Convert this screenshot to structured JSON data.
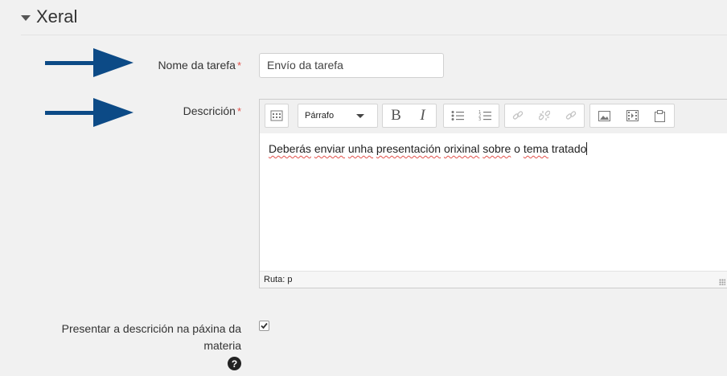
{
  "section": {
    "title": "Xeral"
  },
  "fields": {
    "task_name": {
      "label": "Nome da tarefa",
      "required_mark": "*",
      "value": "Envío da  tarefa"
    },
    "description": {
      "label": "Descrición",
      "required_mark": "*"
    },
    "show_description": {
      "label_line1": "Presentar a descrición na páxina da",
      "label_line2": "materia",
      "checked": true,
      "help_glyph": "?"
    }
  },
  "editor": {
    "paragraph_select": "Párrafo",
    "toolbar_icons": [
      "toggle-toolbar-icon",
      "bold-icon",
      "italic-icon",
      "unordered-list-icon",
      "ordered-list-icon",
      "link-icon",
      "unlink-icon",
      "anchor-icon",
      "image-icon",
      "media-icon",
      "paste-icon"
    ],
    "content_words": [
      "Deberás",
      "enviar",
      "unha",
      "presentación",
      "orixinal",
      "sobre",
      "o",
      "tema",
      "tratado"
    ],
    "misspelled": [
      true,
      true,
      true,
      true,
      true,
      true,
      false,
      true,
      false
    ],
    "status_path": "Ruta: p"
  },
  "colors": {
    "arrow": "#0c4a86",
    "required": "#e2504a",
    "background": "#f1f1f1"
  }
}
